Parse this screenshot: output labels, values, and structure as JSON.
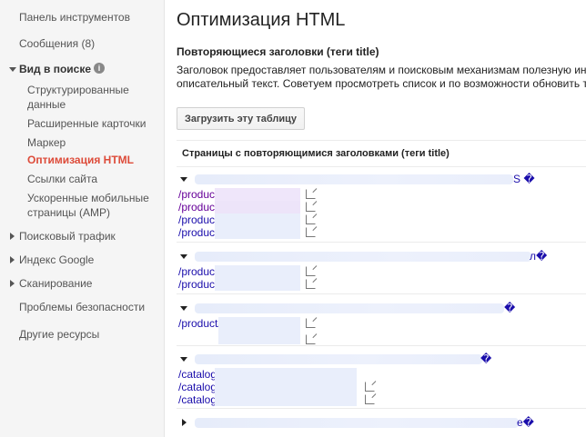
{
  "sidebar": {
    "dashboard": "Панель инструментов",
    "messages": "Сообщения (8)",
    "search_appearance": "Вид в поиске",
    "info_icon": "i",
    "sub_items": {
      "structured": "Структурированные",
      "structured2": "данные",
      "rich_cards": "Расширенные карточки",
      "marker": "Маркер",
      "html_opt": "Оптимизация HTML",
      "sitelinks": "Ссылки сайта",
      "amp": "Ускоренные мобильные",
      "amp2": "страницы (AMP)"
    },
    "search_traffic": "Поисковый трафик",
    "google_index": "Индекс Google",
    "crawl": "Сканирование",
    "security": "Проблемы безопасности",
    "other": "Другие ресурсы"
  },
  "main": {
    "title": "Оптимизация HTML",
    "section_title": "Повторяющиеся заголовки (теги title)",
    "desc_line1": "Заголовок предоставляет пользователям и поисковым механизмам полезную информ",
    "desc_line2": "описательный текст. Советуем просмотреть список и по возможности обновить теги за",
    "download_label": "Загрузить эту таблицу",
    "table_header": "Страницы с повторяющимися заголовками (теги title)",
    "groups": [
      {
        "tail": "S �",
        "urls": [
          "/product",
          "/product",
          "/product",
          "/product"
        ]
      },
      {
        "tail": "л�",
        "urls": [
          "/product",
          "/product"
        ]
      },
      {
        "tail": "�",
        "urls": [
          "/product/"
        ]
      },
      {
        "tail": "�",
        "urls": [
          "/catalog",
          "/catalog",
          "/catalog"
        ]
      },
      {
        "tail": "e�",
        "urls": []
      }
    ]
  }
}
